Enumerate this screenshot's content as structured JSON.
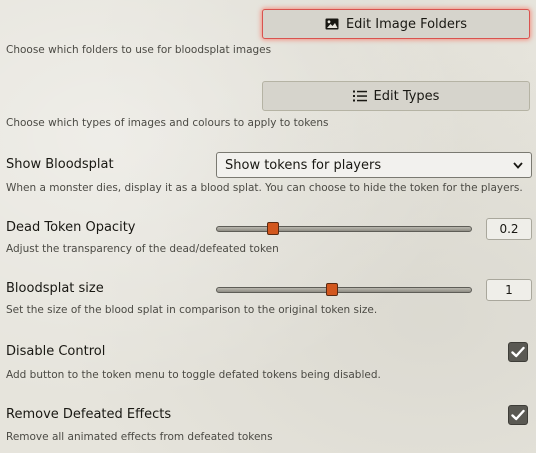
{
  "image_folders": {
    "button_label": "Edit Image Folders",
    "icon": "image-icon",
    "hint": "Choose which folders to use for bloodsplat images"
  },
  "types": {
    "button_label": "Edit Types",
    "icon": "list-icon",
    "hint": "Choose which types of images and colours to apply to tokens"
  },
  "show_bloodsplat": {
    "label": "Show Bloodsplat",
    "selected": "Show tokens for players",
    "hint": "When a monster dies, display it as a blood splat. You can choose to hide the token for the players."
  },
  "dead_token_opacity": {
    "label": "Dead Token Opacity",
    "value": "0.2",
    "slider_fraction": 0.21,
    "hint": "Adjust the transparency of the dead/defeated token"
  },
  "bloodsplat_size": {
    "label": "Bloodsplat size",
    "value": "1",
    "slider_fraction": 0.45,
    "hint": "Set the size of the blood splat in comparison to the original token size."
  },
  "disable_control": {
    "label": "Disable Control",
    "checked": true,
    "hint": "Add button to the token menu to toggle defated tokens being disabled."
  },
  "remove_defeated_effects": {
    "label": "Remove Defeated Effects",
    "checked": true,
    "hint": "Remove all animated effects from defeated tokens"
  },
  "colors": {
    "accent_orange": "#d2571e",
    "focus_red": "#d9534f",
    "checkbox_bg": "#5a5953"
  }
}
